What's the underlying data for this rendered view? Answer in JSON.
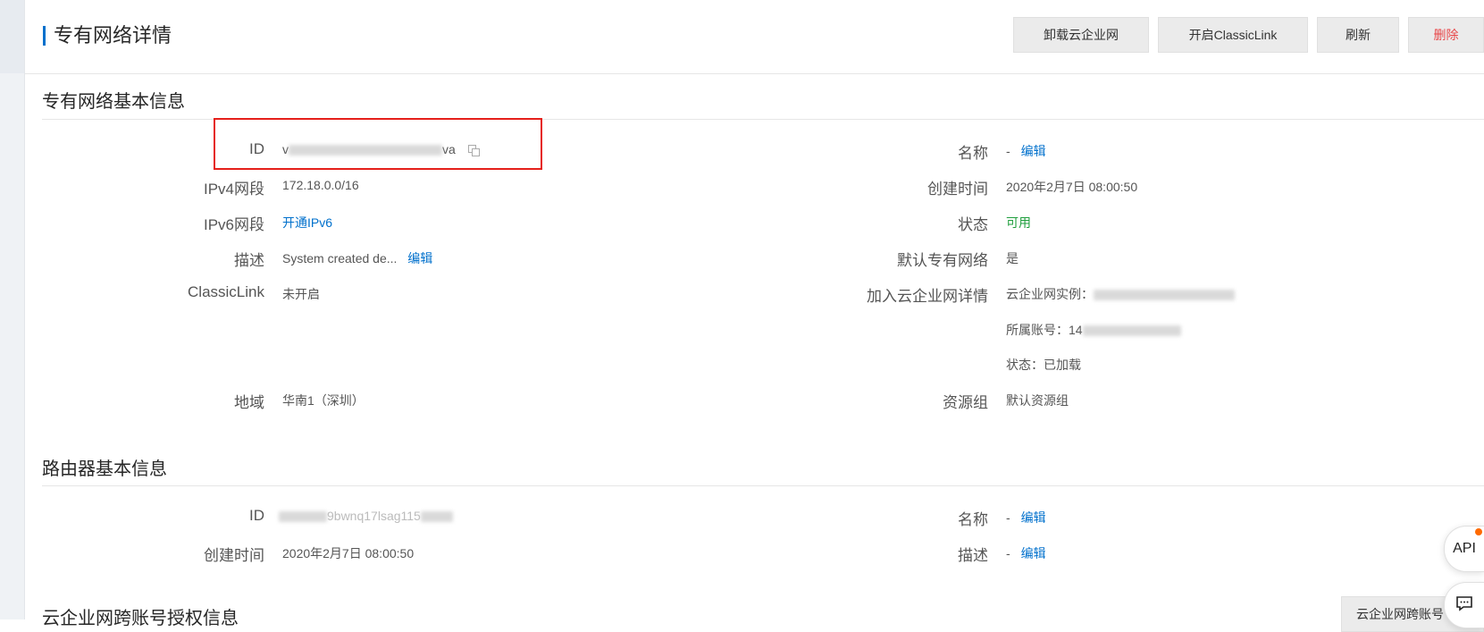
{
  "page": {
    "title": "专有网络详情"
  },
  "toolbar": {
    "uninstall_cen": "卸载云企业网",
    "enable_classiclink": "开启ClassicLink",
    "refresh": "刷新",
    "delete": "删除"
  },
  "vpc_section": {
    "title": "专有网络基本信息",
    "id_label": "ID",
    "id_value_start": "v",
    "id_value_end": "va",
    "ipv4_label": "IPv4网段",
    "ipv4_value": "172.18.0.0/16",
    "ipv6_label": "IPv6网段",
    "ipv6_link": "开通IPv6",
    "desc_label": "描述",
    "desc_value": "System created de...",
    "desc_edit": "编辑",
    "classiclink_label": "ClassicLink",
    "classiclink_value": "未开启",
    "region_label": "地域",
    "region_value": "华南1（深圳）",
    "name_label": "名称",
    "name_value": "-",
    "name_edit": "编辑",
    "created_label": "创建时间",
    "created_value": "2020年2月7日 08:00:50",
    "status_label": "状态",
    "status_value": "可用",
    "default_vpc_label": "默认专有网络",
    "default_vpc_value": "是",
    "cen_label": "加入云企业网详情",
    "cen_instance_prefix": "云企业网实例：",
    "cen_account_prefix": "所属账号：",
    "cen_account_start": "14",
    "cen_status": "状态：已加载",
    "resource_group_label": "资源组",
    "resource_group_value": "默认资源组"
  },
  "router_section": {
    "title": "路由器基本信息",
    "id_label": "ID",
    "id_value_visible": "9bwnq17lsag115",
    "created_label": "创建时间",
    "created_value": "2020年2月7日 08:00:50",
    "name_label": "名称",
    "name_value": "-",
    "name_edit": "编辑",
    "desc_label": "描述",
    "desc_value": "-",
    "desc_edit": "编辑"
  },
  "cen_auth_section": {
    "title": "云企业网跨账号授权信息",
    "button": "云企业网跨账号"
  },
  "floating": {
    "api_label": "API"
  },
  "colors": {
    "accent": "#0070cc",
    "danger": "#e84749",
    "success": "#1e9e3c",
    "highlight": "#e5201b"
  }
}
